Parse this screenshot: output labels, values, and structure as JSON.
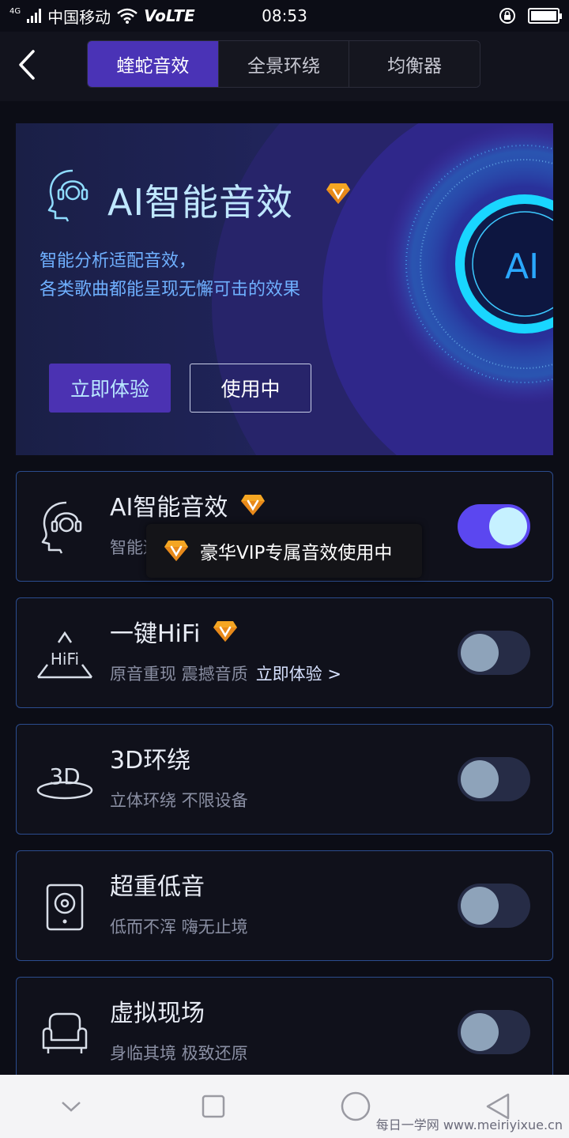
{
  "status": {
    "network": "4G",
    "carrier": "中国移动",
    "volte": "VoLTE",
    "time": "08:53"
  },
  "tabs": [
    {
      "label": "蝰蛇音效",
      "active": true
    },
    {
      "label": "全景环绕",
      "active": false
    },
    {
      "label": "均衡器",
      "active": false
    }
  ],
  "banner": {
    "title": "AI智能音效",
    "sub1": "智能分析适配音效，",
    "sub2": "各类歌曲都能呈现无懈可击的效果",
    "btn_try": "立即体验",
    "btn_inuse": "使用中",
    "orb_label": "AI"
  },
  "effects": [
    {
      "icon": "ai-head-icon",
      "title": "AI智能音效",
      "vip": true,
      "desc": "智能适配 绝佳听感 立即体验",
      "toggle_on": true
    },
    {
      "icon": "hifi-icon",
      "title": "一键HiFi",
      "vip": true,
      "desc": "原音重现 震撼音质",
      "link": "立即体验 >",
      "toggle_on": false
    },
    {
      "icon": "3d-surround-icon",
      "title": "3D环绕",
      "vip": false,
      "desc": "立体环绕 不限设备",
      "toggle_on": false
    },
    {
      "icon": "speaker-icon",
      "title": "超重低音",
      "vip": false,
      "desc": "低而不浑 嗨无止境",
      "toggle_on": false
    },
    {
      "icon": "armchair-icon",
      "title": "虚拟现场",
      "vip": false,
      "desc": "身临其境 极致还原",
      "toggle_on": false
    }
  ],
  "toast": {
    "text": "豪华VIP专属音效使用中"
  },
  "watermark": "每日一学网 www.meiriyixue.cn",
  "colors": {
    "accent": "#4a33b6",
    "toggle_on": "#5b47f0",
    "card_border": "#2b4c8e",
    "vip_gem": "#f5a623"
  }
}
